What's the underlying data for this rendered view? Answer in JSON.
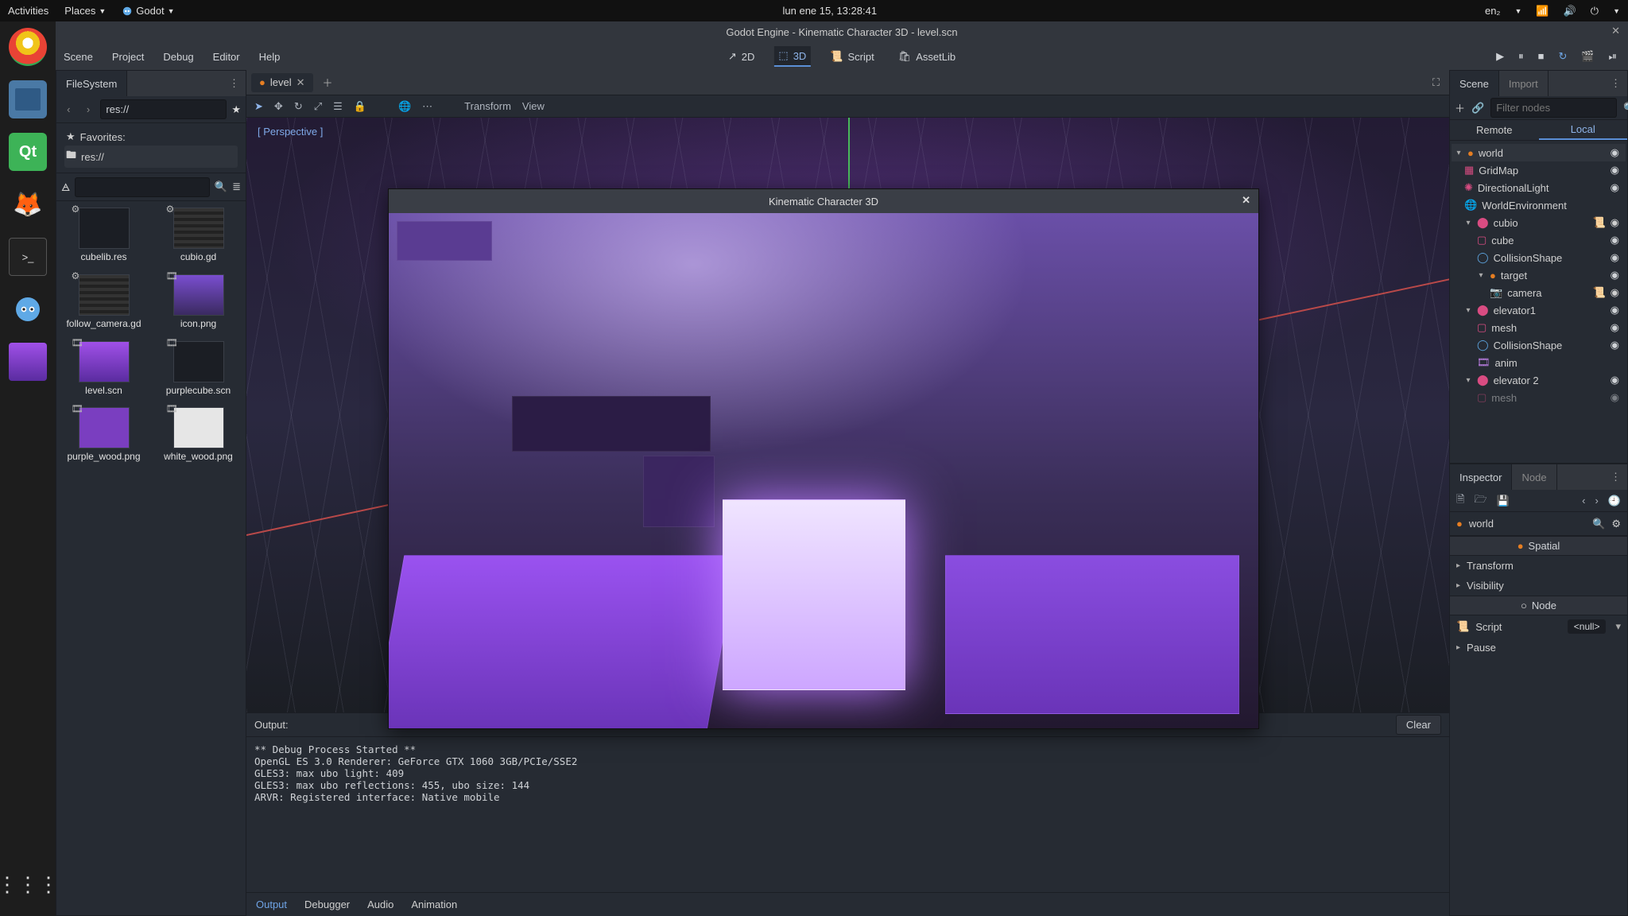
{
  "gnome": {
    "activities": "Activities",
    "places": "Places",
    "app_label": "Godot",
    "clock": "lun ene 15, 13:28:41",
    "lang": "en₂"
  },
  "window_title": "Godot Engine - Kinematic Character 3D - level.scn",
  "menubar": {
    "items": [
      "Scene",
      "Project",
      "Debug",
      "Editor",
      "Help"
    ]
  },
  "workspace_tabs": {
    "twod": "2D",
    "threed": "3D",
    "script": "Script",
    "assetlib": "AssetLib"
  },
  "filesystem": {
    "title": "FileSystem",
    "path": "res://",
    "favorites": "Favorites:",
    "res_label": "res://",
    "items": [
      {
        "name": "cubelib.res"
      },
      {
        "name": "cubio.gd"
      },
      {
        "name": "follow_camera.gd"
      },
      {
        "name": "icon.png"
      },
      {
        "name": "level.scn"
      },
      {
        "name": "purplecube.scn"
      },
      {
        "name": "purple_wood.png"
      },
      {
        "name": "white_wood.png"
      }
    ]
  },
  "scene_tabs": {
    "active": "level"
  },
  "scene_toolbar": {
    "transform": "Transform",
    "view": "View"
  },
  "perspective": "[ Perspective ]",
  "output": {
    "title": "Output:",
    "clear": "Clear",
    "log": "** Debug Process Started **\nOpenGL ES 3.0 Renderer: GeForce GTX 1060 3GB/PCIe/SSE2\nGLES3: max ubo light: 409\nGLES3: max ubo reflections: 455, ubo size: 144\nARVR: Registered interface: Native mobile",
    "tabs": [
      "Output",
      "Debugger",
      "Audio",
      "Animation"
    ]
  },
  "scene_panel": {
    "title": "Scene",
    "import": "Import",
    "filter_placeholder": "Filter nodes",
    "remote": "Remote",
    "local": "Local",
    "nodes": {
      "world": "world",
      "gridmap": "GridMap",
      "dlight": "DirectionalLight",
      "worldenv": "WorldEnvironment",
      "cubio": "cubio",
      "cube": "cube",
      "coll1": "CollisionShape",
      "target": "target",
      "camera": "camera",
      "elev1": "elevator1",
      "mesh": "mesh",
      "coll2": "CollisionShape",
      "anim": "anim",
      "elev2": "elevator 2",
      "mesh2": "mesh"
    }
  },
  "inspector": {
    "title": "Inspector",
    "node_tab": "Node",
    "obj_name": "world",
    "spatial_header": "Spatial",
    "transform": "Transform",
    "visibility": "Visibility",
    "node_header": "Node",
    "script_label": "Script",
    "script_value": "<null>",
    "pause": "Pause"
  },
  "game_window": {
    "title": "Kinematic Character 3D"
  }
}
